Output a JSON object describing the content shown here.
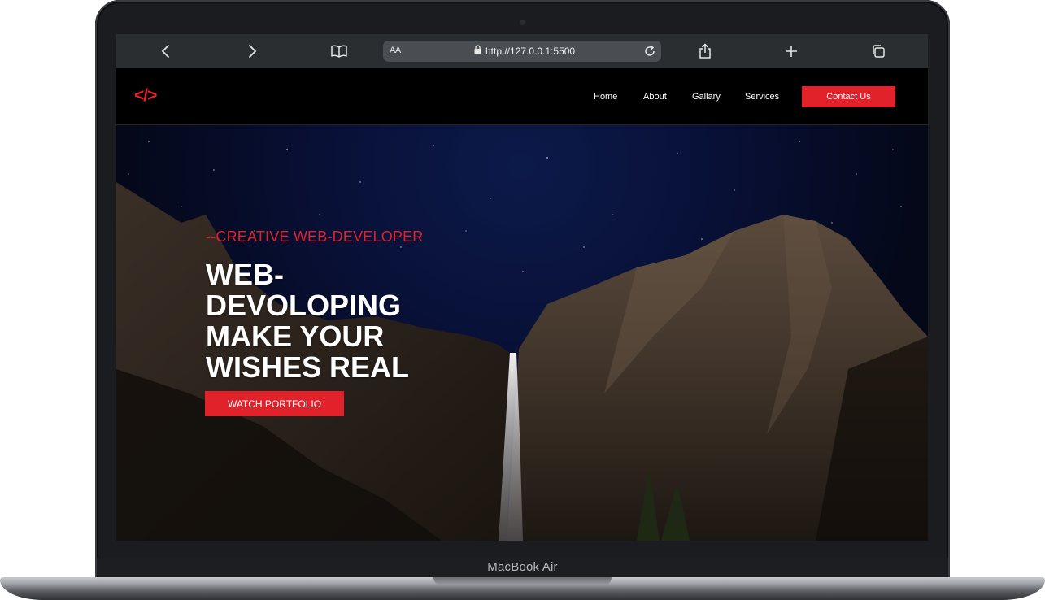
{
  "device": {
    "label": "MacBook Air"
  },
  "browser": {
    "reader_label": "AA",
    "url": "http://127.0.0.1:5500",
    "icons": {
      "back": "chevron-left-icon",
      "forward": "chevron-right-icon",
      "bookmarks": "book-icon",
      "lock": "lock-icon",
      "reload": "reload-icon",
      "share": "share-icon",
      "new_tab": "plus-icon",
      "tabs": "tabs-icon"
    }
  },
  "site": {
    "logo": "</>",
    "nav": {
      "items": [
        "Home",
        "About",
        "Gallary",
        "Services"
      ],
      "cta": "Contact Us"
    },
    "hero": {
      "tagline": "--CREATIVE WEB-DEVELOPER",
      "headline_lines": [
        "WEB-",
        "DEVOLOPING",
        "MAKE YOUR",
        "WISHES REAL"
      ],
      "button": "WATCH PORTFOLIO"
    },
    "colors": {
      "accent": "#e1222a",
      "nav_bg": "#000000",
      "sky": "#081036"
    }
  }
}
